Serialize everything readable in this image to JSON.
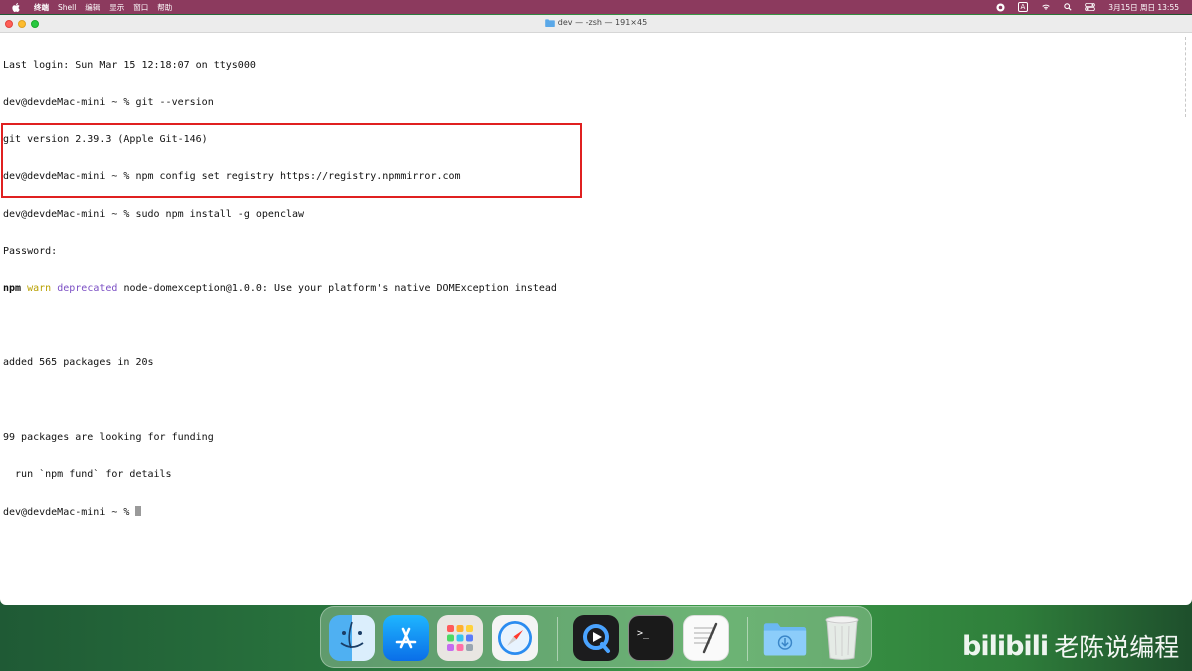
{
  "menubar": {
    "items": [
      "终端",
      "Shell",
      "编辑",
      "显示",
      "窗口",
      "帮助"
    ],
    "clock": "3月15日 周日 13:55",
    "input_method": "A"
  },
  "window": {
    "title": "dev — -zsh — 191×45"
  },
  "terminal": {
    "lines": [
      "Last login: Sun Mar 15 12:18:07 on ttys000",
      "dev@devdeMac-mini ~ % git --version",
      "git version 2.39.3 (Apple Git-146)",
      "dev@devdeMac-mini ~ % npm config set registry https://registry.npmmirror.com",
      "dev@devdeMac-mini ~ % sudo npm install -g openclaw",
      "Password:"
    ],
    "warn_line": {
      "npm": "npm",
      "warn": "warn",
      "deprecated": "deprecated",
      "message": " node-domexception@1.0.0: Use your platform's native DOMException instead"
    },
    "lines_after": [
      "",
      "added 565 packages in 20s",
      "",
      "99 packages are looking for funding",
      "  run `npm fund` for details"
    ],
    "prompt": "dev@devdeMac-mini ~ % "
  },
  "dock": {
    "apps": [
      {
        "icon": "finder-icon"
      },
      {
        "icon": "app-store-icon"
      },
      {
        "icon": "launchpad-icon"
      },
      {
        "icon": "safari-icon"
      },
      {
        "icon": "quicktime-icon"
      },
      {
        "icon": "terminal-icon"
      },
      {
        "icon": "textedit-icon"
      },
      {
        "icon": "downloads-folder-icon"
      },
      {
        "icon": "trash-icon"
      }
    ]
  },
  "watermark": {
    "brand": "bilibili",
    "text": "老陈说编程"
  },
  "colors": {
    "menubar": "#8c3a5e",
    "highlight": "#e02020",
    "warn": "#b8a000",
    "deprecated": "#7b4fc4"
  }
}
